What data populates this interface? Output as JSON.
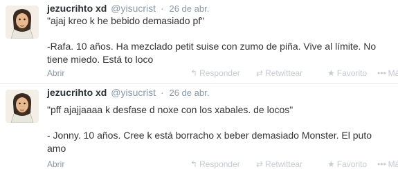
{
  "tweets": [
    {
      "fullname": "jezucrihto xd",
      "username": "@yisucrist",
      "separator": "·",
      "time": "26 de abr.",
      "line1": "\"ajaj kreo k he bebido demasiado pf\"",
      "line2": "-Rafa. 10 años. Ha mezclado petit suise con zumo de piña. Vive al límite. No tiene miedo. Está to loco",
      "open": "Abrir",
      "reply": "Responder",
      "retweet": "Retwittear",
      "favorite": "Favorito",
      "more": "Más"
    },
    {
      "fullname": "jezucrihto xd",
      "username": "@yisucrist",
      "separator": "·",
      "time": "26 de abr.",
      "line1": "\"pff ajajjaaaa k desfase d noxe con los xabales. de locos\"",
      "line2": "- Jonny. 10 años. Cree k está borracho x beber demasiado Monster. El puto amo",
      "open": "Abrir",
      "reply": "Responder",
      "retweet": "Retwittear",
      "favorite": "Favorito",
      "more": "Más"
    }
  ],
  "icons": {
    "reply": "reply-arrow-icon",
    "retweet": "retweet-icon",
    "favorite": "star-icon",
    "more": "more-dots-icon"
  },
  "colors": {
    "name": "#292f33",
    "muted": "#8899a6",
    "action": "#c4cbd1"
  }
}
